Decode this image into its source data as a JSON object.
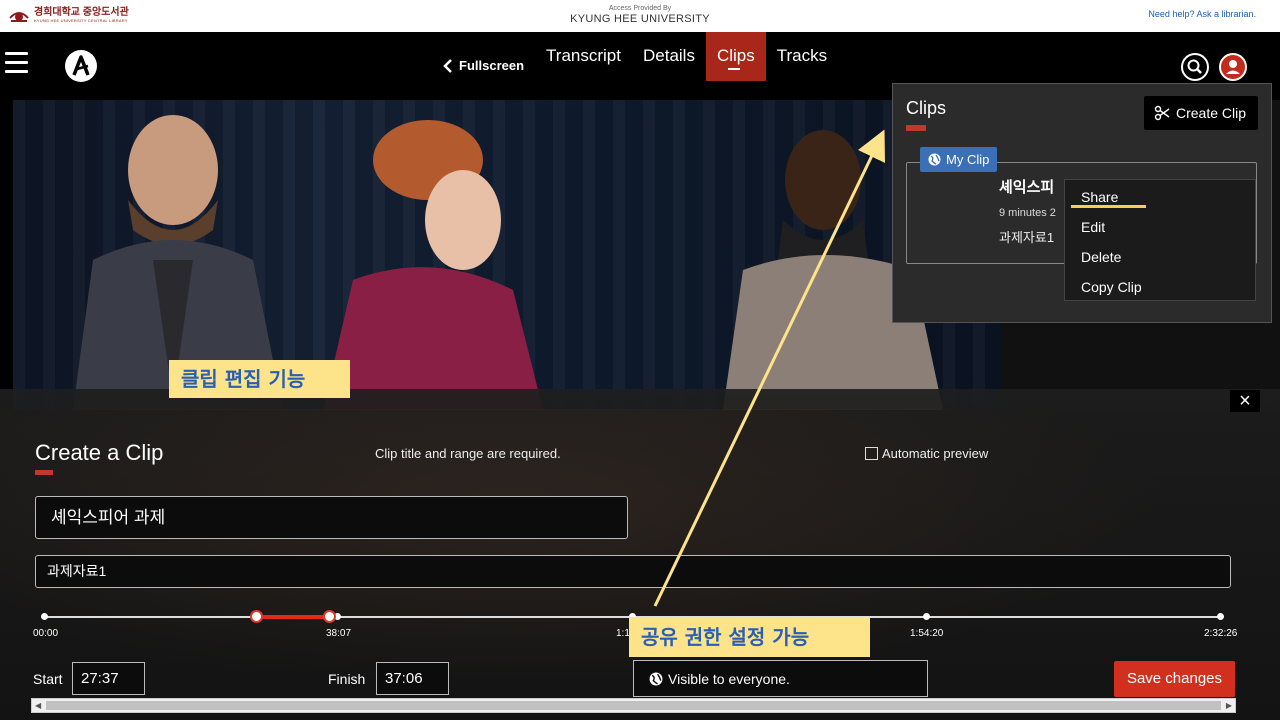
{
  "topbar": {
    "library_name_ko": "경희대학교 중앙도서관",
    "library_name_en": "KYUNG HEE UNIVERSITY CENTRAL LIBRARY",
    "access_caption": "Access Provided By",
    "access_name": "KYUNG HEE UNIVERSITY",
    "help_link": "Need help? Ask a librarian."
  },
  "nav": {
    "back_label": "Fullscreen",
    "tabs": [
      "Transcript",
      "Details",
      "Clips",
      "Tracks"
    ],
    "active_tab": "Clips"
  },
  "clips_panel": {
    "title": "Clips",
    "create_button": "Create Clip",
    "badge": "My Clip",
    "clip_title": "셰익스피",
    "clip_meta": "9 minutes 2",
    "clip_desc": "과제자료1",
    "menu": [
      "Share",
      "Edit",
      "Delete",
      "Copy Clip"
    ]
  },
  "create_clip": {
    "heading": "Create a Clip",
    "required_note": "Clip title and range are required.",
    "auto_preview": "Automatic preview",
    "title_value": "셰익스피어 과제",
    "description_value": "과제자료1",
    "timeline_labels": [
      "00:00",
      "38:07",
      "1:1",
      "1:54:20",
      "2:32:26"
    ],
    "start_label": "Start",
    "start_value": "27:37",
    "finish_label": "Finish",
    "finish_value": "37:06",
    "visibility": "Visible to everyone.",
    "save_button": "Save changes",
    "close": "×"
  },
  "annotations": {
    "clip_edit": "클립 편집 기능",
    "share_perm": "공유 권한 설정 가능"
  },
  "colors": {
    "accent_red": "#c0392b",
    "badge_blue": "#3b6fb6",
    "annotation_yellow": "#fde38a",
    "annotation_text": "#2a5fb4"
  }
}
